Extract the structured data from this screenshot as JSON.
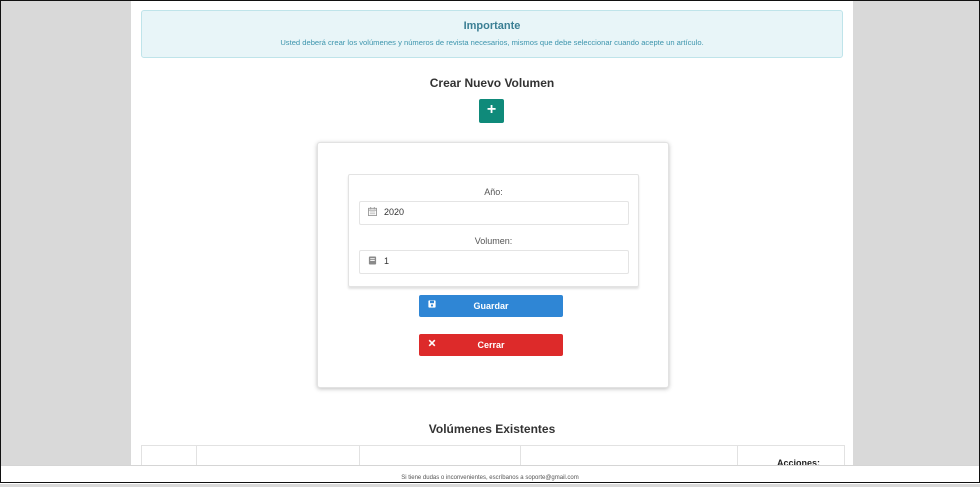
{
  "alert": {
    "title": "Importante",
    "text": "Usted deberá crear los volúmenes y números de revista necesarios, mismos que debe seleccionar cuando acepte un artículo."
  },
  "create_section": {
    "title": "Crear Nuevo Volumen",
    "add_icon": "plus-icon",
    "add_label": "+"
  },
  "form": {
    "year_label": "Año:",
    "year_value": "2020",
    "year_icon": "calendar-icon",
    "volume_label": "Volumen:",
    "volume_value": "1",
    "volume_icon": "book-icon",
    "save_label": "Guardar",
    "save_icon": "save-icon",
    "close_label": "Cerrar",
    "close_icon": "close-icon"
  },
  "existing_section": {
    "title": "Volúmenes Existentes",
    "columns": [
      "",
      "",
      "",
      "",
      "Acciones:"
    ]
  },
  "footer": {
    "text": "Si tiene dudas o inconvenientes, escríbanos a soporte@gmail.com"
  },
  "colors": {
    "add_button": "#0f8a7a",
    "save_button": "#2f86d5",
    "close_button": "#dd2a2a",
    "alert_bg": "#e8f5f8"
  }
}
